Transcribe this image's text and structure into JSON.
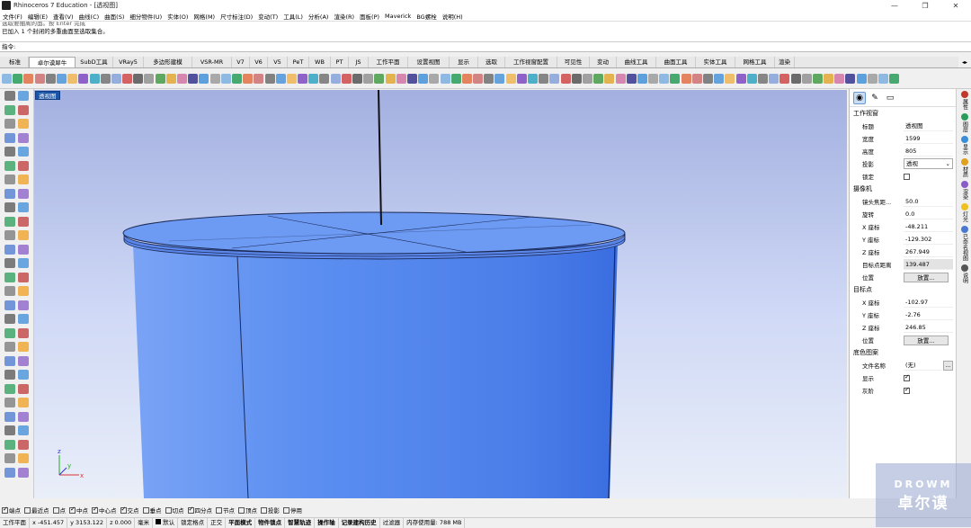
{
  "window": {
    "title": "Rhinoceros 7 Education - [透视图]",
    "controls": [
      "—",
      "❐",
      "✕"
    ]
  },
  "menu": [
    "文件(F)",
    "编辑(E)",
    "查看(V)",
    "曲线(C)",
    "曲面(S)",
    "细分物件(U)",
    "实体(O)",
    "网格(M)",
    "尺寸标注(D)",
    "变动(T)",
    "工具(L)",
    "分析(A)",
    "渲染(R)",
    "面板(P)",
    "Maverick",
    "BG螺栓",
    "说明(H)"
  ],
  "command": {
    "line1": "选取要抽离的面。按 Enter 完成",
    "line2": "已加入 1 个封闭的多重曲面至选取集合。",
    "prompt": "指令:"
  },
  "tabs": [
    "标准",
    "工作平面",
    "设置视图",
    "显示",
    "选取",
    "工作视窗配置",
    "可见性",
    "变动",
    "曲线工具",
    "曲面工具",
    "实体工具",
    "网格工具",
    "渲染"
  ],
  "tabs_full": [
    "标准",
    "卓尔谟犀牛",
    "SubD工具",
    "VRay5",
    "多边形建模",
    "VSR-MR",
    "V7",
    "V6",
    "V5",
    "PeT",
    "WB",
    "PT",
    "JS",
    "工作平面",
    "设置视图",
    "显示",
    "选取",
    "工作视窗配置",
    "可见性",
    "变动",
    "曲线工具",
    "曲面工具",
    "实体工具",
    "网格工具",
    "渲染"
  ],
  "active_tab": "卓尔谟犀牛",
  "viewport": {
    "label": "透视图",
    "axes": {
      "x": "x",
      "y": "y",
      "z": "z"
    }
  },
  "panel": {
    "section_viewport": "工作视窗",
    "title_label": "标题",
    "title_value": "透视图",
    "width_label": "宽度",
    "width_value": "1599",
    "height_label": "高度",
    "height_value": "805",
    "projection_label": "投影",
    "projection_value": "透视",
    "locked_label": "锁定",
    "section_camera": "摄像机",
    "lens_label": "镜头焦距...",
    "lens_value": "50.0",
    "rotation_label": "旋转",
    "rotation_value": "0.0",
    "cx_label": "X 座标",
    "cx_value": "-48.211",
    "cy_label": "Y 座标",
    "cy_value": "-129.302",
    "cz_label": "Z 座标",
    "cz_value": "267.949",
    "dist_label": "目标点距离",
    "dist_value": "139.487",
    "pos_label": "位置",
    "pos_button": "放置...",
    "section_target": "目标点",
    "tx_label": "X 座标",
    "tx_value": "-102.97",
    "ty_label": "Y 座标",
    "ty_value": "-2.76",
    "tz_label": "Z 座标",
    "tz_value": "246.85",
    "tpos_label": "位置",
    "tpos_button": "放置...",
    "section_bg": "底色图案",
    "file_label": "文件名称",
    "file_value": "(无)",
    "show_label": "显示",
    "gray_label": "灰阶"
  },
  "right_strip": [
    "属性",
    "图层",
    "显示",
    "材质",
    "渲染",
    "灯光",
    "已命名视图",
    "说明"
  ],
  "snaps": [
    {
      "label": "端点",
      "on": true
    },
    {
      "label": "最近点",
      "on": false
    },
    {
      "label": "点",
      "on": false
    },
    {
      "label": "中点",
      "on": true
    },
    {
      "label": "中心点",
      "on": true
    },
    {
      "label": "交点",
      "on": true
    },
    {
      "label": "垂点",
      "on": false
    },
    {
      "label": "切点",
      "on": false
    },
    {
      "label": "四分点",
      "on": true
    },
    {
      "label": "节点",
      "on": false
    },
    {
      "label": "顶点",
      "on": false
    },
    {
      "label": "投影",
      "on": false
    },
    {
      "label": "停用",
      "on": false
    }
  ],
  "status": {
    "cplane": "工作平面",
    "x": "x -451.457",
    "y": "y 3153.122",
    "z": "z 0.000",
    "unit": "毫米",
    "layer": "默认",
    "items": [
      "锁定格点",
      "正交",
      "平面模式",
      "物件锁点",
      "智慧轨迹",
      "操作轴",
      "记录建构历史",
      "过滤器",
      "内存使用量: 788 MB"
    ]
  },
  "watermark": {
    "line1": "DROWM",
    "line2": "卓尔谟"
  },
  "colors": {
    "accent": "#1a55a8",
    "cylinder": "#5b8ff2"
  }
}
